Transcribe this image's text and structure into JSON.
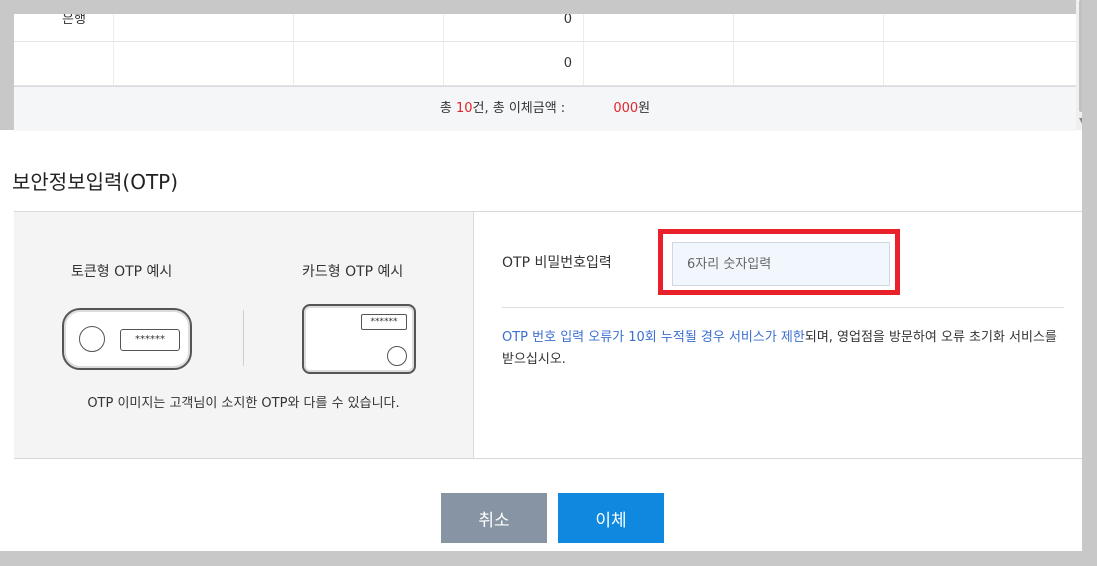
{
  "table": {
    "rows": [
      {
        "bank": "은행",
        "amount": "0"
      },
      {
        "bank": "",
        "amount": "0"
      }
    ],
    "summary": {
      "prefix": "총 ",
      "count": "10",
      "count_suffix": "건,  총 이체금액 : ",
      "amount_masked": "",
      "amount_tail": "000",
      "currency": "원"
    }
  },
  "otp_section": {
    "title": "보안정보입력(OTP)",
    "token_label": "토큰형 OTP 예시",
    "card_label": "카드형 OTP 예시",
    "token_screen": "******",
    "card_screen": "******",
    "image_note": "OTP 이미지는 고객님이 소지한 OTP와 다를 수 있습니다.",
    "password_label": "OTP 비밀번호입력",
    "password_placeholder": "6자리 숫자입력",
    "warning_blue": "OTP 번호 입력 오류가 10회 누적될 경우 서비스가 제한",
    "warning_rest": "되며, 영업점을 방문하여 오류 초기화 서비스를 받으십시오."
  },
  "buttons": {
    "cancel": "취소",
    "confirm": "이체"
  },
  "colors": {
    "accent": "#0f88e0",
    "highlight": "#e8212b",
    "cancel": "#8694a3"
  }
}
